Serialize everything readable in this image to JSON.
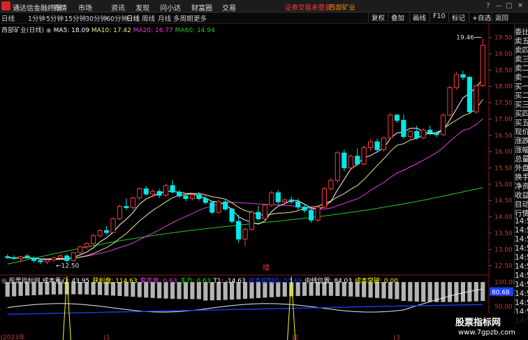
{
  "app": {
    "title": "通达信金融终端",
    "login_status": "证券交易未登录",
    "stock_name": "西部矿业"
  },
  "menu": [
    "行情",
    "市场",
    "资讯",
    "发现",
    "问小达",
    "财富圈",
    "交易"
  ],
  "window_buttons": [
    "?",
    "—",
    "□",
    "✕"
  ],
  "periods": {
    "items": [
      "日线",
      "1分钟",
      "5分钟",
      "15分钟",
      "30分钟",
      "60分钟",
      "日线",
      "周线",
      "月线",
      "多周期",
      "更多"
    ],
    "active": "日线"
  },
  "toolbar": [
    "复权",
    "叠加",
    "画线",
    "F10",
    "标记",
    "+自选",
    "返回"
  ],
  "chart_title": "西部矿业(日线)",
  "ma_legend": {
    "ma5": "MA5: 18.09",
    "ma10": "MA10: 17.42",
    "ma20": "MA20: 16.77",
    "ma60": "MA60: 14.94"
  },
  "colors": {
    "up": "#ff3c3c",
    "down": "#00e8e8",
    "ma5": "#ffffff",
    "ma10": "#f0e68c",
    "ma20": "#e040e0",
    "ma60": "#22cc22",
    "ind_line": "#2040ff"
  },
  "price_axis": [
    "19.50",
    "19.00",
    "18.50",
    "18.00",
    "17.50",
    "17.00",
    "16.50",
    "16.00",
    "15.50",
    "15.00",
    "14.50",
    "14.00",
    "13.50",
    "13.00",
    "12.50"
  ],
  "annotations": {
    "high": "19.46",
    "low": "12.50",
    "signal": "增"
  },
  "indicator": {
    "name": "股票指标网",
    "items": [
      {
        "label": "成本重心:",
        "value": "43.95",
        "color": "#ffffff"
      },
      {
        "label": "获利盘:",
        "value": "114.63",
        "color": "#ffff00"
      },
      {
        "label": "套牢盘:",
        "value": "0.63",
        "color": "#e040e0"
      },
      {
        "label": "主力:",
        "value": "0.63",
        "color": "#00ff00"
      },
      {
        "label": "T1:",
        "value": "-14.63",
        "color": "#ffffff"
      },
      {
        "label": "成本控制位:",
        "value": "55.69",
        "color": "#2040ff"
      },
      {
        "label": "中线位置:",
        "value": "84.03",
        "color": "#ffffff"
      },
      {
        "label": "成本突破:",
        "value": "0.00",
        "color": "#ffff00"
      }
    ],
    "axis": [
      "100.00",
      "75.00",
      "50.00"
    ],
    "current": "80.68"
  },
  "date_axis": [
    "2023年",
    "1",
    "2",
    "3"
  ],
  "side_panel": [
    "委比",
    "卖五",
    "卖四",
    "卖三",
    "卖二",
    "卖一",
    "买一",
    "买二",
    "买三",
    "买四",
    "买五",
    "现价",
    "涨跌",
    "涨幅",
    "总量",
    "外盘",
    "换手",
    "净资",
    "收益",
    "目动",
    "行情",
    "14:5",
    "14:5",
    "14:5",
    "14:5",
    "14:5",
    "14:5",
    "14:5",
    "14:5",
    "14:5",
    "14:5",
    "14:5",
    "14:5"
  ],
  "watermark": {
    "line1": "股票指标网",
    "line2": "www.7gpzb.com"
  },
  "chart_data": {
    "type": "candlestick",
    "ylim": [
      12.3,
      19.75
    ],
    "candles": [
      [
        12.78,
        12.85,
        12.7,
        12.75
      ],
      [
        12.75,
        12.82,
        12.68,
        12.72
      ],
      [
        12.72,
        12.8,
        12.6,
        12.78
      ],
      [
        12.8,
        12.86,
        12.72,
        12.74
      ],
      [
        12.74,
        12.78,
        12.6,
        12.66
      ],
      [
        12.66,
        12.7,
        12.55,
        12.62
      ],
      [
        12.62,
        12.7,
        12.55,
        12.68
      ],
      [
        12.68,
        12.78,
        12.62,
        12.74
      ],
      [
        12.74,
        12.86,
        12.7,
        12.8
      ],
      [
        12.8,
        12.86,
        12.6,
        12.66
      ],
      [
        12.66,
        12.92,
        12.62,
        12.9
      ],
      [
        12.9,
        13.12,
        12.86,
        13.08
      ],
      [
        13.08,
        13.22,
        13.0,
        13.18
      ],
      [
        13.18,
        13.48,
        13.12,
        13.42
      ],
      [
        13.42,
        13.62,
        13.36,
        13.58
      ],
      [
        13.58,
        13.72,
        13.46,
        13.52
      ],
      [
        13.52,
        13.98,
        13.5,
        13.94
      ],
      [
        13.94,
        14.38,
        13.9,
        14.32
      ],
      [
        14.32,
        14.56,
        14.2,
        14.28
      ],
      [
        14.28,
        14.62,
        14.22,
        14.58
      ],
      [
        14.58,
        14.9,
        14.5,
        14.86
      ],
      [
        14.86,
        14.94,
        14.64,
        14.7
      ],
      [
        14.7,
        14.84,
        14.6,
        14.78
      ],
      [
        14.78,
        14.86,
        14.58,
        14.66
      ],
      [
        14.66,
        15.02,
        14.62,
        14.96
      ],
      [
        14.96,
        15.12,
        14.72,
        14.76
      ],
      [
        14.76,
        14.82,
        14.58,
        14.64
      ],
      [
        14.64,
        14.7,
        14.48,
        14.56
      ],
      [
        14.56,
        14.74,
        14.5,
        14.68
      ],
      [
        14.68,
        14.76,
        14.5,
        14.56
      ],
      [
        14.56,
        14.64,
        14.38,
        14.44
      ],
      [
        14.44,
        14.48,
        14.08,
        14.14
      ],
      [
        14.14,
        14.52,
        14.1,
        14.46
      ],
      [
        14.46,
        14.52,
        14.18,
        14.24
      ],
      [
        14.24,
        14.28,
        13.8,
        13.86
      ],
      [
        13.86,
        14.06,
        13.2,
        13.32
      ],
      [
        13.32,
        13.68,
        13.1,
        13.62
      ],
      [
        13.62,
        14.2,
        13.58,
        14.14
      ],
      [
        14.14,
        14.34,
        13.88,
        13.94
      ],
      [
        13.94,
        14.4,
        13.9,
        14.36
      ],
      [
        14.36,
        14.8,
        14.3,
        14.74
      ],
      [
        14.74,
        14.82,
        14.4,
        14.46
      ],
      [
        14.46,
        14.58,
        14.38,
        14.52
      ],
      [
        14.52,
        14.62,
        14.4,
        14.46
      ],
      [
        14.46,
        14.56,
        14.22,
        14.3
      ],
      [
        14.3,
        14.4,
        14.12,
        14.2
      ],
      [
        14.2,
        14.3,
        13.82,
        13.9
      ],
      [
        13.9,
        14.36,
        13.84,
        14.3
      ],
      [
        14.3,
        14.92,
        14.26,
        14.86
      ],
      [
        14.86,
        15.18,
        14.8,
        15.12
      ],
      [
        15.12,
        16.02,
        15.06,
        15.96
      ],
      [
        15.96,
        16.06,
        15.4,
        15.5
      ],
      [
        15.5,
        15.92,
        15.44,
        15.86
      ],
      [
        15.86,
        16.1,
        15.56,
        15.62
      ],
      [
        15.62,
        16.18,
        15.58,
        16.12
      ],
      [
        16.12,
        16.38,
        16.02,
        16.3
      ],
      [
        16.3,
        16.4,
        15.96,
        16.06
      ],
      [
        16.06,
        16.46,
        16.0,
        16.42
      ],
      [
        16.42,
        17.18,
        16.38,
        17.12
      ],
      [
        17.12,
        17.16,
        16.88,
        16.96
      ],
      [
        16.96,
        17.14,
        16.4,
        16.46
      ],
      [
        16.46,
        16.66,
        16.4,
        16.62
      ],
      [
        16.62,
        16.8,
        16.36,
        16.42
      ],
      [
        16.42,
        16.72,
        16.38,
        16.66
      ],
      [
        16.66,
        16.8,
        16.5,
        16.58
      ],
      [
        16.58,
        16.64,
        16.44,
        16.52
      ],
      [
        16.52,
        17.18,
        16.48,
        17.12
      ],
      [
        17.12,
        18.02,
        17.08,
        17.96
      ],
      [
        17.96,
        18.44,
        17.9,
        18.36
      ],
      [
        18.36,
        18.48,
        18.2,
        18.28
      ],
      [
        18.28,
        18.32,
        17.16,
        17.22
      ],
      [
        17.22,
        18.06,
        17.16,
        18.02
      ],
      [
        18.02,
        19.46,
        17.98,
        19.26
      ]
    ],
    "ma_last": {
      "ma5": 18.09,
      "ma10": 17.42,
      "ma20": 16.77,
      "ma60": 14.94
    }
  }
}
